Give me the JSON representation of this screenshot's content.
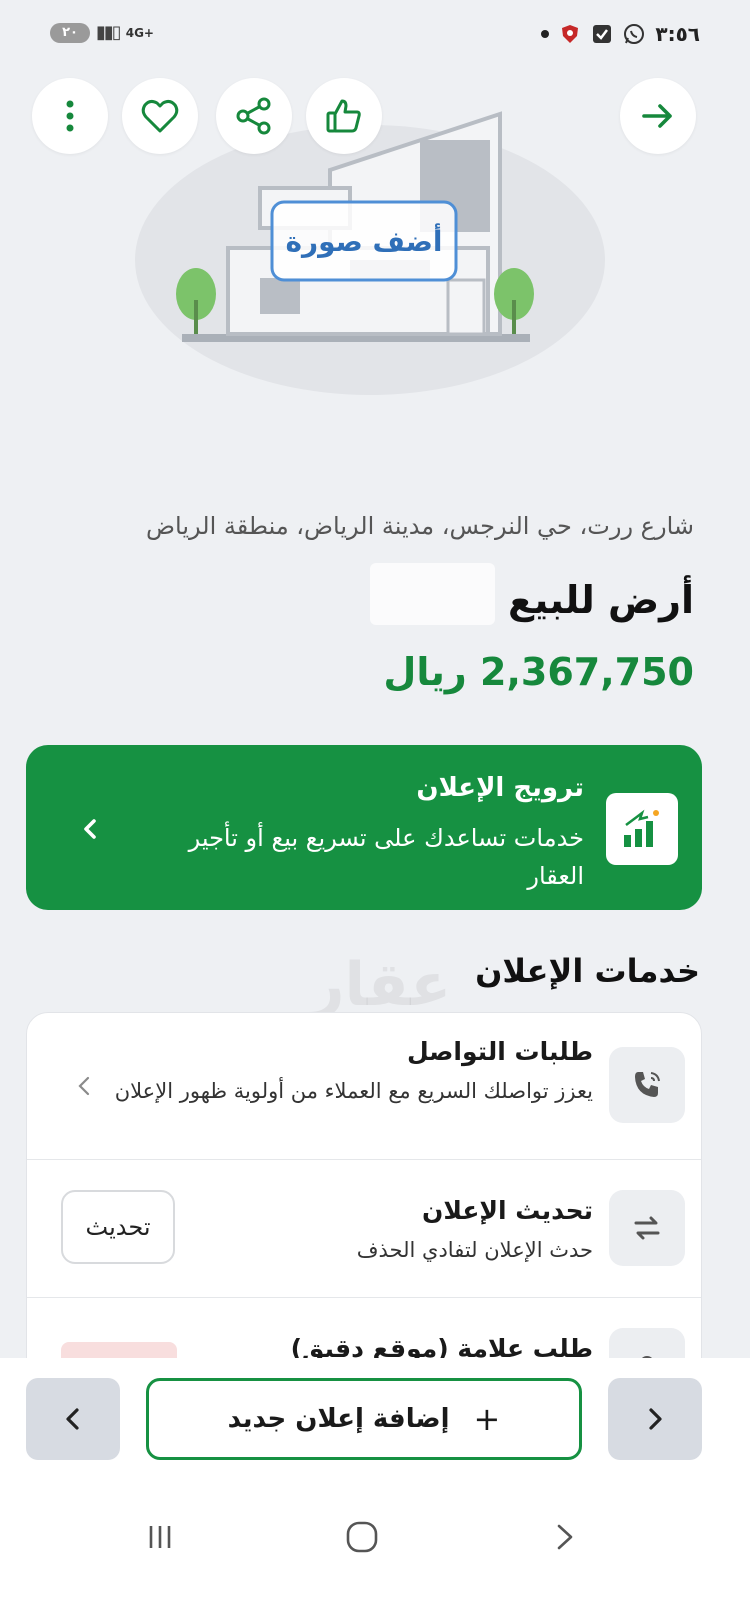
{
  "status_bar": {
    "time": "٣:٥٦",
    "battery": "٢٠",
    "network": "4G+"
  },
  "top_actions": {
    "back_icon": "arrow-right-icon",
    "like_icon": "thumbs-up-icon",
    "share_icon": "share-icon",
    "favorite_icon": "heart-icon",
    "more_icon": "more-vertical-icon"
  },
  "hero": {
    "add_photo_label": "أضف صورة"
  },
  "listing": {
    "address": "شارع ررت، حي النرجس، مدينة الرياض، منطقة الرياض",
    "title": "أرض للبيع",
    "price": "2,367,750 ريال"
  },
  "promo": {
    "title": "ترويج الإعلان",
    "description": "خدمات تساعدك على تسريع بيع أو تأجير العقار",
    "accent": "#169142"
  },
  "services_section": {
    "title": "خدمات الإعلان",
    "watermark": "عقار",
    "items": [
      {
        "title": "طلبات التواصل",
        "description": "يعزز تواصلك السريع مع العملاء من أولوية ظهور الإعلان",
        "icon": "phone-icon"
      },
      {
        "title": "تحديث الإعلان",
        "description": "حدث الإعلان لتفادي الحذف",
        "action_label": "تحديث",
        "icon": "swap-arrows-icon"
      },
      {
        "title": "طلب علامة (موقع دقيق)",
        "icon": "location-pin-icon"
      }
    ]
  },
  "bottom_bar": {
    "add_listing_label": "إضافة إعلان جديد",
    "plus_symbol": "+"
  },
  "colors": {
    "brand_green": "#169142",
    "price_green": "#16883c",
    "background": "#eef0f3"
  }
}
